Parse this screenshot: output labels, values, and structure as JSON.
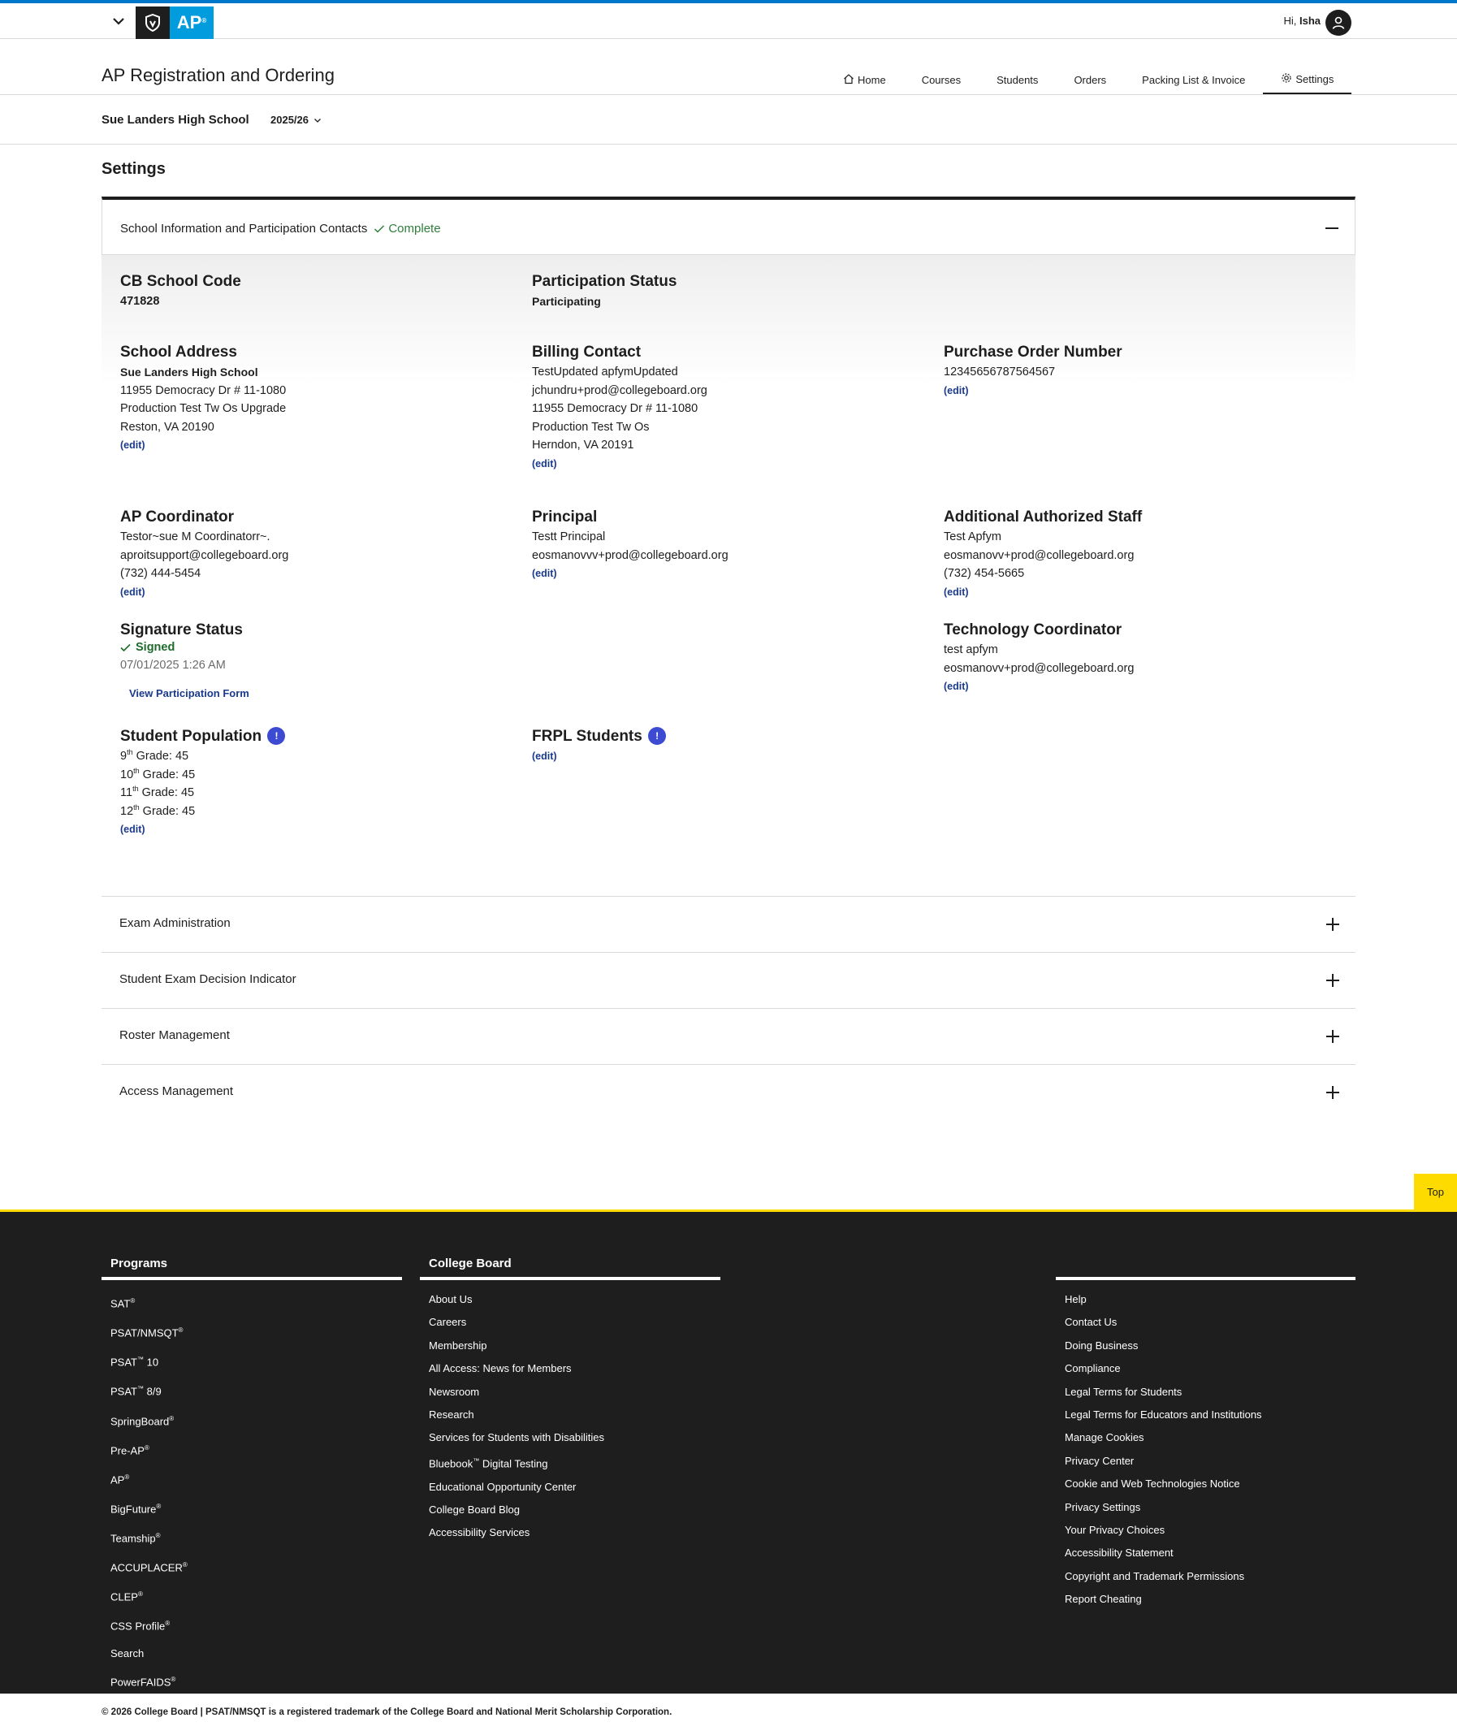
{
  "topbar": {
    "greeting_prefix": "Hi, ",
    "user_name": "Isha",
    "ap_logo": "AP"
  },
  "header": {
    "app_title": "AP Registration and Ordering",
    "nav": [
      {
        "label": "Home",
        "icon": "home-icon"
      },
      {
        "label": "Courses"
      },
      {
        "label": "Students"
      },
      {
        "label": "Orders"
      },
      {
        "label": "Packing List & Invoice"
      },
      {
        "label": "Settings",
        "icon": "gear-icon",
        "active": true
      }
    ],
    "school_name": "Sue Landers High School",
    "year": "2025/26"
  },
  "page_title": "Settings",
  "school_info": {
    "title": "School Information and Participation Contacts",
    "status": "Complete",
    "cb_code_label": "CB School Code",
    "cb_code": "471828",
    "participation_label": "Participation Status",
    "participation": "Participating",
    "address_label": "School Address",
    "address": [
      "Sue Landers High School",
      "11955 Democracy Dr # 11-1080",
      "Production Test Tw Os Upgrade",
      "Reston, VA 20190"
    ],
    "billing_label": "Billing Contact",
    "billing": [
      "TestUpdated apfymUpdated",
      "jchundru+prod@collegeboard.org",
      "11955 Democracy Dr # 11-1080",
      "Production Test Tw Os",
      "Herndon, VA 20191"
    ],
    "po_label": "Purchase Order Number",
    "po": "12345656787564567",
    "coord_label": "AP Coordinator",
    "coord": [
      "Testor~sue M Coordinatorr~.",
      "aproitsupport@collegeboard.org",
      "(732) 444-5454"
    ],
    "principal_label": "Principal",
    "principal": [
      "Testt Principal",
      "eosmanovvv+prod@collegeboard.org"
    ],
    "staff_label": "Additional Authorized Staff",
    "staff": [
      "Test Apfym",
      "eosmanovv+prod@collegeboard.org",
      "(732) 454-5665"
    ],
    "signature_label": "Signature Status",
    "signed": "Signed",
    "signed_date": "07/01/2025 1:26 AM",
    "view_form": "View Participation Form",
    "tech_label": "Technology Coordinator",
    "tech": [
      "test apfym",
      "eosmanovv+prod@collegeboard.org"
    ],
    "population_label": "Student Population",
    "grades": [
      {
        "num": "9",
        "suffix": "th",
        "text": " Grade: 45"
      },
      {
        "num": "10",
        "suffix": "th",
        "text": " Grade: 45"
      },
      {
        "num": "11",
        "suffix": "th",
        "text": " Grade: 45"
      },
      {
        "num": "12",
        "suffix": "th",
        "text": " Grade: 45"
      }
    ],
    "frpl_label": "FRPL Students",
    "edit": "(edit)"
  },
  "accordions": [
    "Exam Administration",
    "Student Exam Decision Indicator",
    "Roster Management",
    "Access Management"
  ],
  "top_button": "Top",
  "footer": {
    "programs_title": "Programs",
    "programs": [
      {
        "t": "SAT",
        "s": "®"
      },
      {
        "t": "PSAT/NMSQT",
        "s": "®"
      },
      {
        "t": "PSAT",
        "s": "™",
        "a": " 10"
      },
      {
        "t": "PSAT",
        "s": "™",
        "a": " 8/9"
      },
      {
        "t": "SpringBoard",
        "s": "®"
      },
      {
        "t": "Pre-AP",
        "s": "®"
      },
      {
        "t": "AP",
        "s": "®"
      },
      {
        "t": "BigFuture",
        "s": "®"
      },
      {
        "t": "Teamship",
        "s": "®"
      },
      {
        "t": "ACCUPLACER",
        "s": "®"
      },
      {
        "t": "CLEP",
        "s": "®"
      },
      {
        "t": "CSS Profile",
        "s": "®"
      },
      {
        "t": "Search",
        "s": ""
      },
      {
        "t": "PowerFAIDS",
        "s": "®"
      }
    ],
    "cb_title": "College Board",
    "cb_links": [
      {
        "t": "About Us",
        "s": ""
      },
      {
        "t": "Careers",
        "s": ""
      },
      {
        "t": "Membership",
        "s": ""
      },
      {
        "t": "All Access: News for Members",
        "s": ""
      },
      {
        "t": "Newsroom",
        "s": ""
      },
      {
        "t": "Research",
        "s": ""
      },
      {
        "t": "Services for Students with Disabilities",
        "s": ""
      },
      {
        "t": "Bluebook",
        "s": "™",
        "a": " Digital Testing"
      },
      {
        "t": "Educational Opportunity Center",
        "s": ""
      },
      {
        "t": "College Board Blog",
        "s": ""
      },
      {
        "t": "Accessibility Services",
        "s": ""
      }
    ],
    "help_links": [
      "Help",
      "Contact Us",
      "Doing Business",
      "Compliance",
      "Legal Terms for Students",
      "Legal Terms for Educators and Institutions",
      "Manage Cookies",
      "Privacy Center",
      "Cookie and Web Technologies Notice",
      "Privacy Settings",
      "Your Privacy Choices",
      "Accessibility Statement",
      "Copyright and Trademark Permissions",
      "Report Cheating"
    ],
    "copyright": "© 2026 College Board | PSAT/NMSQT is a registered trademark of the College Board and National Merit Scholarship Corporation."
  }
}
